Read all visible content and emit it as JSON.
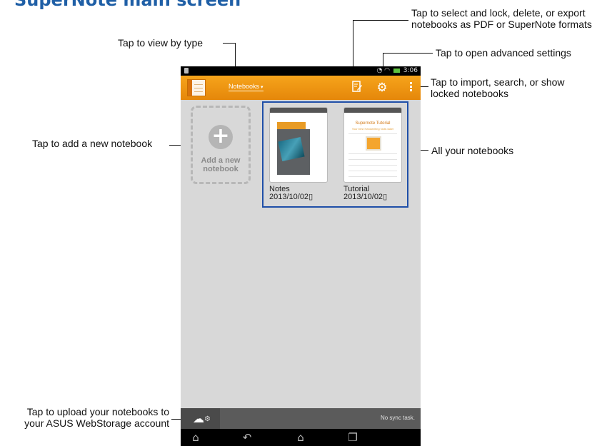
{
  "page_title": "SuperNote main screen",
  "callouts": {
    "view_by_type": "Tap to view by type",
    "select_lock_line1": "Tap to select and lock, delete, or export",
    "select_lock_line2": "notebooks as PDF or SuperNote formats",
    "advanced_settings": "Tap to open advanced settings",
    "import_line1": "Tap to import, search, or show",
    "import_line2": "locked notebooks",
    "add_notebook": "Tap to add a new notebook",
    "all_notebooks": "All your notebooks",
    "upload_line1": "Tap to upload your notebooks to",
    "upload_line2": "your ASUS WebStorage account"
  },
  "status_bar": {
    "time": "3:06"
  },
  "action_bar": {
    "view_menu_label": "Notebooks",
    "caret": "▾",
    "icons": {
      "edit": "edit-icon",
      "settings": "gear-icon",
      "overflow": "overflow-menu-icon"
    }
  },
  "add_tile": {
    "line1": "Add a new",
    "line2": "notebook",
    "icon": "+"
  },
  "notebooks": [
    {
      "name": "Notes",
      "date": "2013/10/02"
    },
    {
      "name": "Tutorial",
      "date": "2013/10/02",
      "cover_title": "Supernote Tutorial",
      "cover_subtitle": "Your best Handwriting Note-taker"
    }
  ],
  "bottom_bar": {
    "sync_status": "No sync task."
  },
  "colors": {
    "action_bar": "#f39a12",
    "callout_frame": "#1f4fa8",
    "title": "#1f5fa6"
  }
}
